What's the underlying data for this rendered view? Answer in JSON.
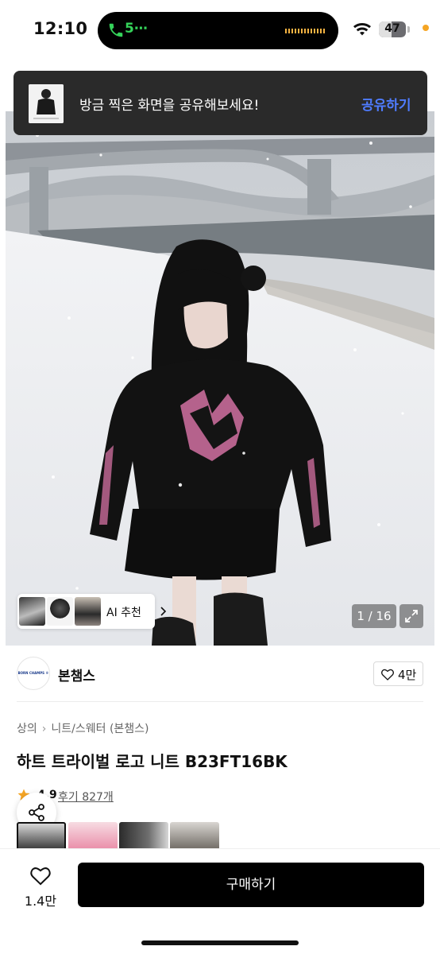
{
  "status_bar": {
    "time": "12:10",
    "call_indicator": "5⋯",
    "battery": "47",
    "battery_level": 0.47,
    "icons": [
      "phone-icon",
      "wifi-icon",
      "battery-icon"
    ],
    "call_color": "#35d35a",
    "indicator_color": "#f5a524"
  },
  "toast": {
    "message": "방금 찍은 화면을 공유해보세요!",
    "action": "공유하기",
    "action_color": "#4f7cff"
  },
  "gallery": {
    "counter": "1 / 16",
    "ai_label": "AI 추천",
    "icons": [
      "expand-icon",
      "chevron-right-icon"
    ]
  },
  "brand": {
    "name": "본챔스",
    "logo_text": "BORN CHAMPS ®",
    "likes": "4만",
    "icon": "heart-icon"
  },
  "product": {
    "breadcrumb": [
      "상의",
      "니트/스웨터 (본챔스)"
    ],
    "title": "하트 트라이벌 로고 니트 B23FT16BK",
    "rating": "4.9",
    "reviews": "후기 827개",
    "rating_color": "#f5a524"
  },
  "actions": {
    "share_icon": "share-icon",
    "like_count": "1.4만",
    "buy_label": "구매하기"
  }
}
